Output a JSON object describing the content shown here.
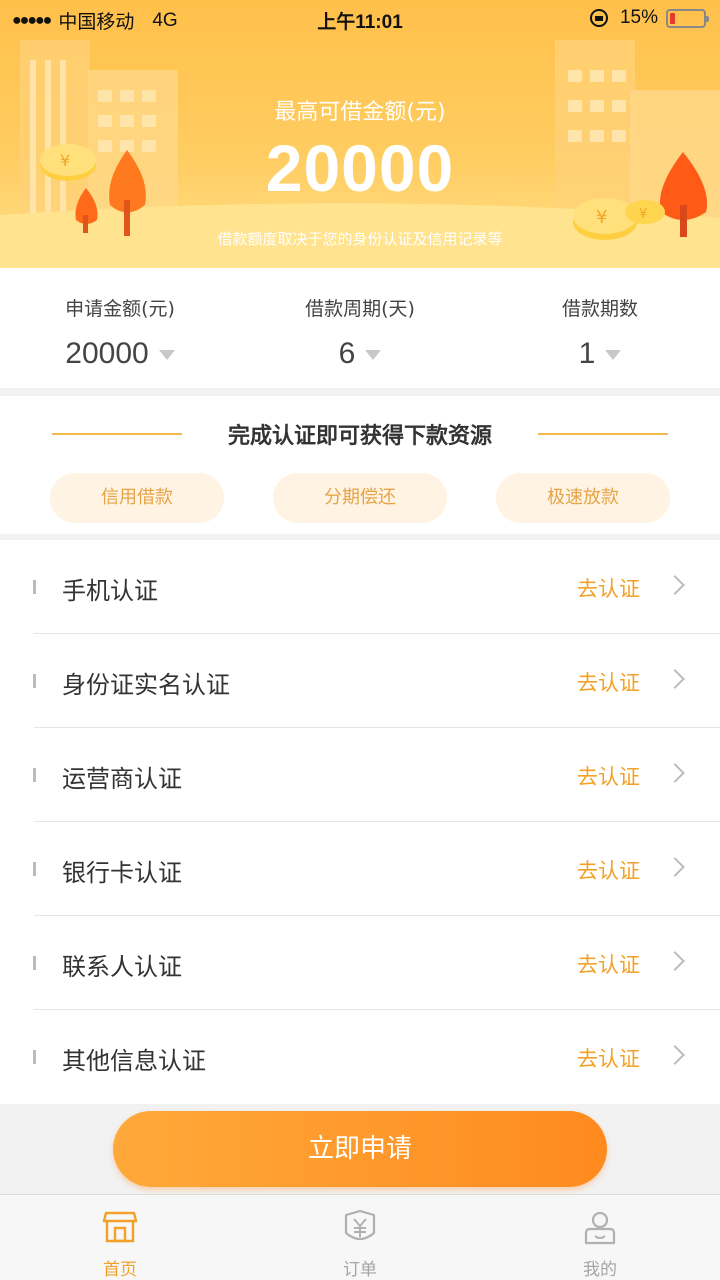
{
  "status_bar": {
    "signal": "●●●●●",
    "carrier": "中国移动",
    "network": "4G",
    "time": "上午11:01",
    "battery": "15%",
    "battery_level": 0.15
  },
  "hero": {
    "label": "最高可借金额(元)",
    "amount": "20000",
    "note": "借款额度取决于您的身份认证及信用记录等"
  },
  "params": [
    {
      "label": "申请金额(元)",
      "value": "20000"
    },
    {
      "label": "借款周期(天)",
      "value": "6"
    },
    {
      "label": "借款期数",
      "value": "1"
    }
  ],
  "cert": {
    "title": "完成认证即可获得下款资源",
    "tags": [
      "信用借款",
      "分期偿还",
      "极速放款"
    ]
  },
  "items": [
    {
      "name": "手机认证",
      "action": "去认证"
    },
    {
      "name": "身份证实名认证",
      "action": "去认证"
    },
    {
      "name": "运营商认证",
      "action": "去认证"
    },
    {
      "name": "银行卡认证",
      "action": "去认证"
    },
    {
      "name": "联系人认证",
      "action": "去认证"
    },
    {
      "name": "其他信息认证",
      "action": "去认证"
    }
  ],
  "apply_label": "立即申请",
  "tabs": [
    {
      "label": "首页",
      "icon": "shop-icon",
      "active": true
    },
    {
      "label": "订单",
      "icon": "yen-receipt-icon",
      "active": false
    },
    {
      "label": "我的",
      "icon": "user-icon",
      "active": false
    }
  ],
  "colors": {
    "accent": "#f2a22a",
    "button": "#ff8a1e",
    "tag_bg": "#fff3e3"
  }
}
